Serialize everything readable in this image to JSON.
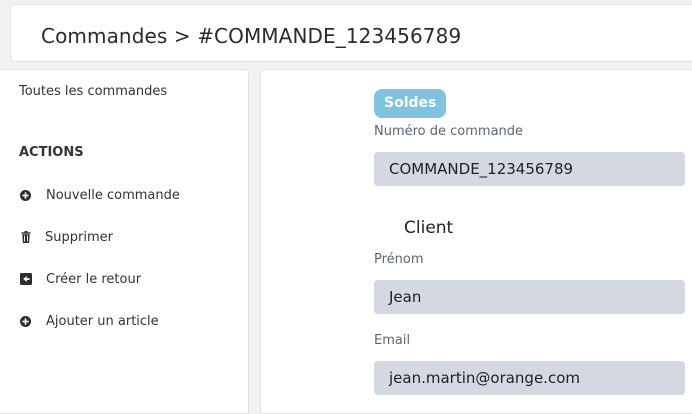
{
  "header": {
    "breadcrumb": "Commandes > #COMMANDE_123456789"
  },
  "sidebar": {
    "all_orders_link": "Toutes les commandes",
    "actions_heading": "ACTIONS",
    "actions": [
      {
        "label": "Nouvelle commande",
        "icon": "plus-circle-icon"
      },
      {
        "label": "Supprimer",
        "icon": "trash-icon"
      },
      {
        "label": "Créer le retour",
        "icon": "return-arrow-icon"
      },
      {
        "label": "Ajouter un article",
        "icon": "plus-circle-icon"
      }
    ]
  },
  "main": {
    "badge": "Soldes",
    "order_number_label": "Numéro de commande",
    "order_number_value": "COMMANDE_123456789",
    "client_section_title": "Client",
    "first_name_label": "Prénom",
    "first_name_value": "Jean",
    "email_label": "Email",
    "email_value": "jean.martin@orange.com"
  },
  "colors": {
    "badge_bg": "#80c3e0",
    "input_bg": "#d3d8e1",
    "page_bg": "#f2f2f2"
  }
}
